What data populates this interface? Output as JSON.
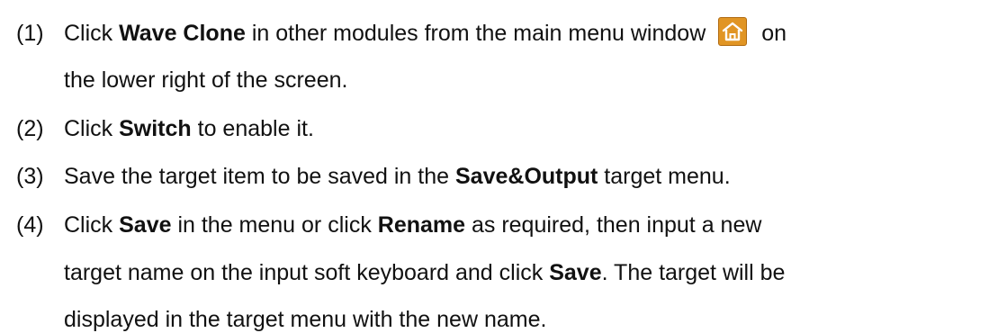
{
  "steps": [
    {
      "number": "(1)",
      "parts": {
        "a": "Click ",
        "b": "Wave Clone",
        "c": " in other modules from the main menu window",
        "d": "on",
        "e": "the lower right of the screen."
      },
      "icon": "home-icon"
    },
    {
      "number": "(2)",
      "parts": {
        "a": "Click ",
        "b": "Switch",
        "c": " to enable it."
      }
    },
    {
      "number": "(3)",
      "parts": {
        "a": "Save the target item to be saved in the ",
        "b": "Save&Output",
        "c": " target menu."
      }
    },
    {
      "number": "(4)",
      "parts": {
        "a": "Click ",
        "b": "Save",
        "c": " in the menu or click ",
        "d": "Rename",
        "e": " as required, then input a new",
        "f": "target name on the input soft keyboard and click ",
        "g": "Save",
        "h": ". The target will be",
        "i": "displayed in the target menu with the new name."
      }
    }
  ],
  "colors": {
    "text": "#111111",
    "icon_bg": "#e19524",
    "icon_glyph": "#ffffff"
  }
}
